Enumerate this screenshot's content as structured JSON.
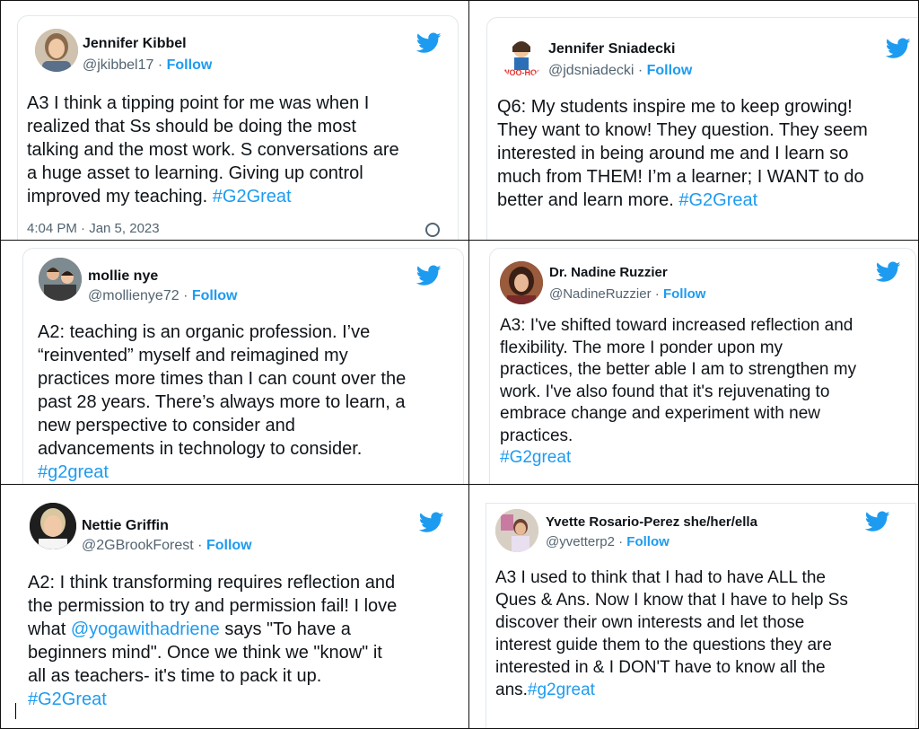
{
  "colors": {
    "link": "#1d9bf0",
    "handle": "#536471",
    "text": "#0f1419"
  },
  "tweets": [
    {
      "name": "Jennifer Kibbel",
      "handle": "@jkibbel17",
      "follow": "Follow",
      "lines": [
        "A3 I think a tipping point for me was when I",
        "realized that Ss should be doing the most",
        "talking and the most work. S conversations are",
        "a huge asset to learning. Giving up control",
        "improved my teaching."
      ],
      "hashtag": "#G2Great",
      "timestamp": "4:04 PM · Jan 5, 2023",
      "icon": "twitter-bird-icon"
    },
    {
      "name": "Jennifer Sniadecki",
      "handle": "@jdsniadecki",
      "follow": "Follow",
      "lines": [
        "Q6: My students inspire me to keep growing!",
        "They want to know! They question. They seem",
        "interested in being around me and I learn so",
        "much from THEM! I’m a learner; I WANT to do",
        "better and learn more."
      ],
      "hashtag": "#G2Great",
      "avatar_text": "WOO-HOO",
      "icon": "twitter-bird-icon"
    },
    {
      "name": "mollie nye",
      "handle": "@mollienye72",
      "follow": "Follow",
      "lines": [
        "A2: teaching is an organic profession. I’ve",
        "“reinvented” myself and reimagined my",
        "practices more times than I can count over the",
        "past 28 years. There’s always more to learn, a",
        "new perspective to consider and",
        "advancements in technology to consider."
      ],
      "hashtag": "#g2great",
      "icon": "twitter-bird-icon"
    },
    {
      "name": "Dr. Nadine Ruzzier",
      "handle": "@NadineRuzzier",
      "follow": "Follow",
      "lines": [
        "A3: I've shifted toward increased reflection and",
        "flexibility. The more I ponder upon my",
        "practices, the better able I am to strengthen my",
        "work. I've also found that it's rejuvenating to",
        "embrace change and experiment with new",
        "practices."
      ],
      "hashtag": "#G2great",
      "icon": "twitter-bird-icon"
    },
    {
      "name": "Nettie Griffin",
      "handle": "@2GBrookForest",
      "follow": "Follow",
      "line1": "A2: I think transforming requires reflection and",
      "line2": "the permission to try and permission fail! I love",
      "line3_pre": "what ",
      "mention": "@yogawithadriene",
      "line3_post": "  says \"To have a",
      "line4": "beginners mind\".  Once we think we \"know\" it",
      "line5": "all as teachers- it's time to pack it up.",
      "hashtag": "#G2Great",
      "icon": "twitter-bird-icon"
    },
    {
      "name": "Yvette Rosario-Perez she/her/ella",
      "handle": "@yvetterp2",
      "follow": "Follow",
      "lines": [
        "A3 I used to think that I had to have ALL the",
        "Ques & Ans. Now I know that I have to help Ss",
        "discover their own interests and let those",
        "interest guide them to the questions they are",
        "interested in & I DON'T have to know all the"
      ],
      "last_pre": "ans.",
      "hashtag": "#g2great",
      "icon": "twitter-bird-icon"
    }
  ]
}
